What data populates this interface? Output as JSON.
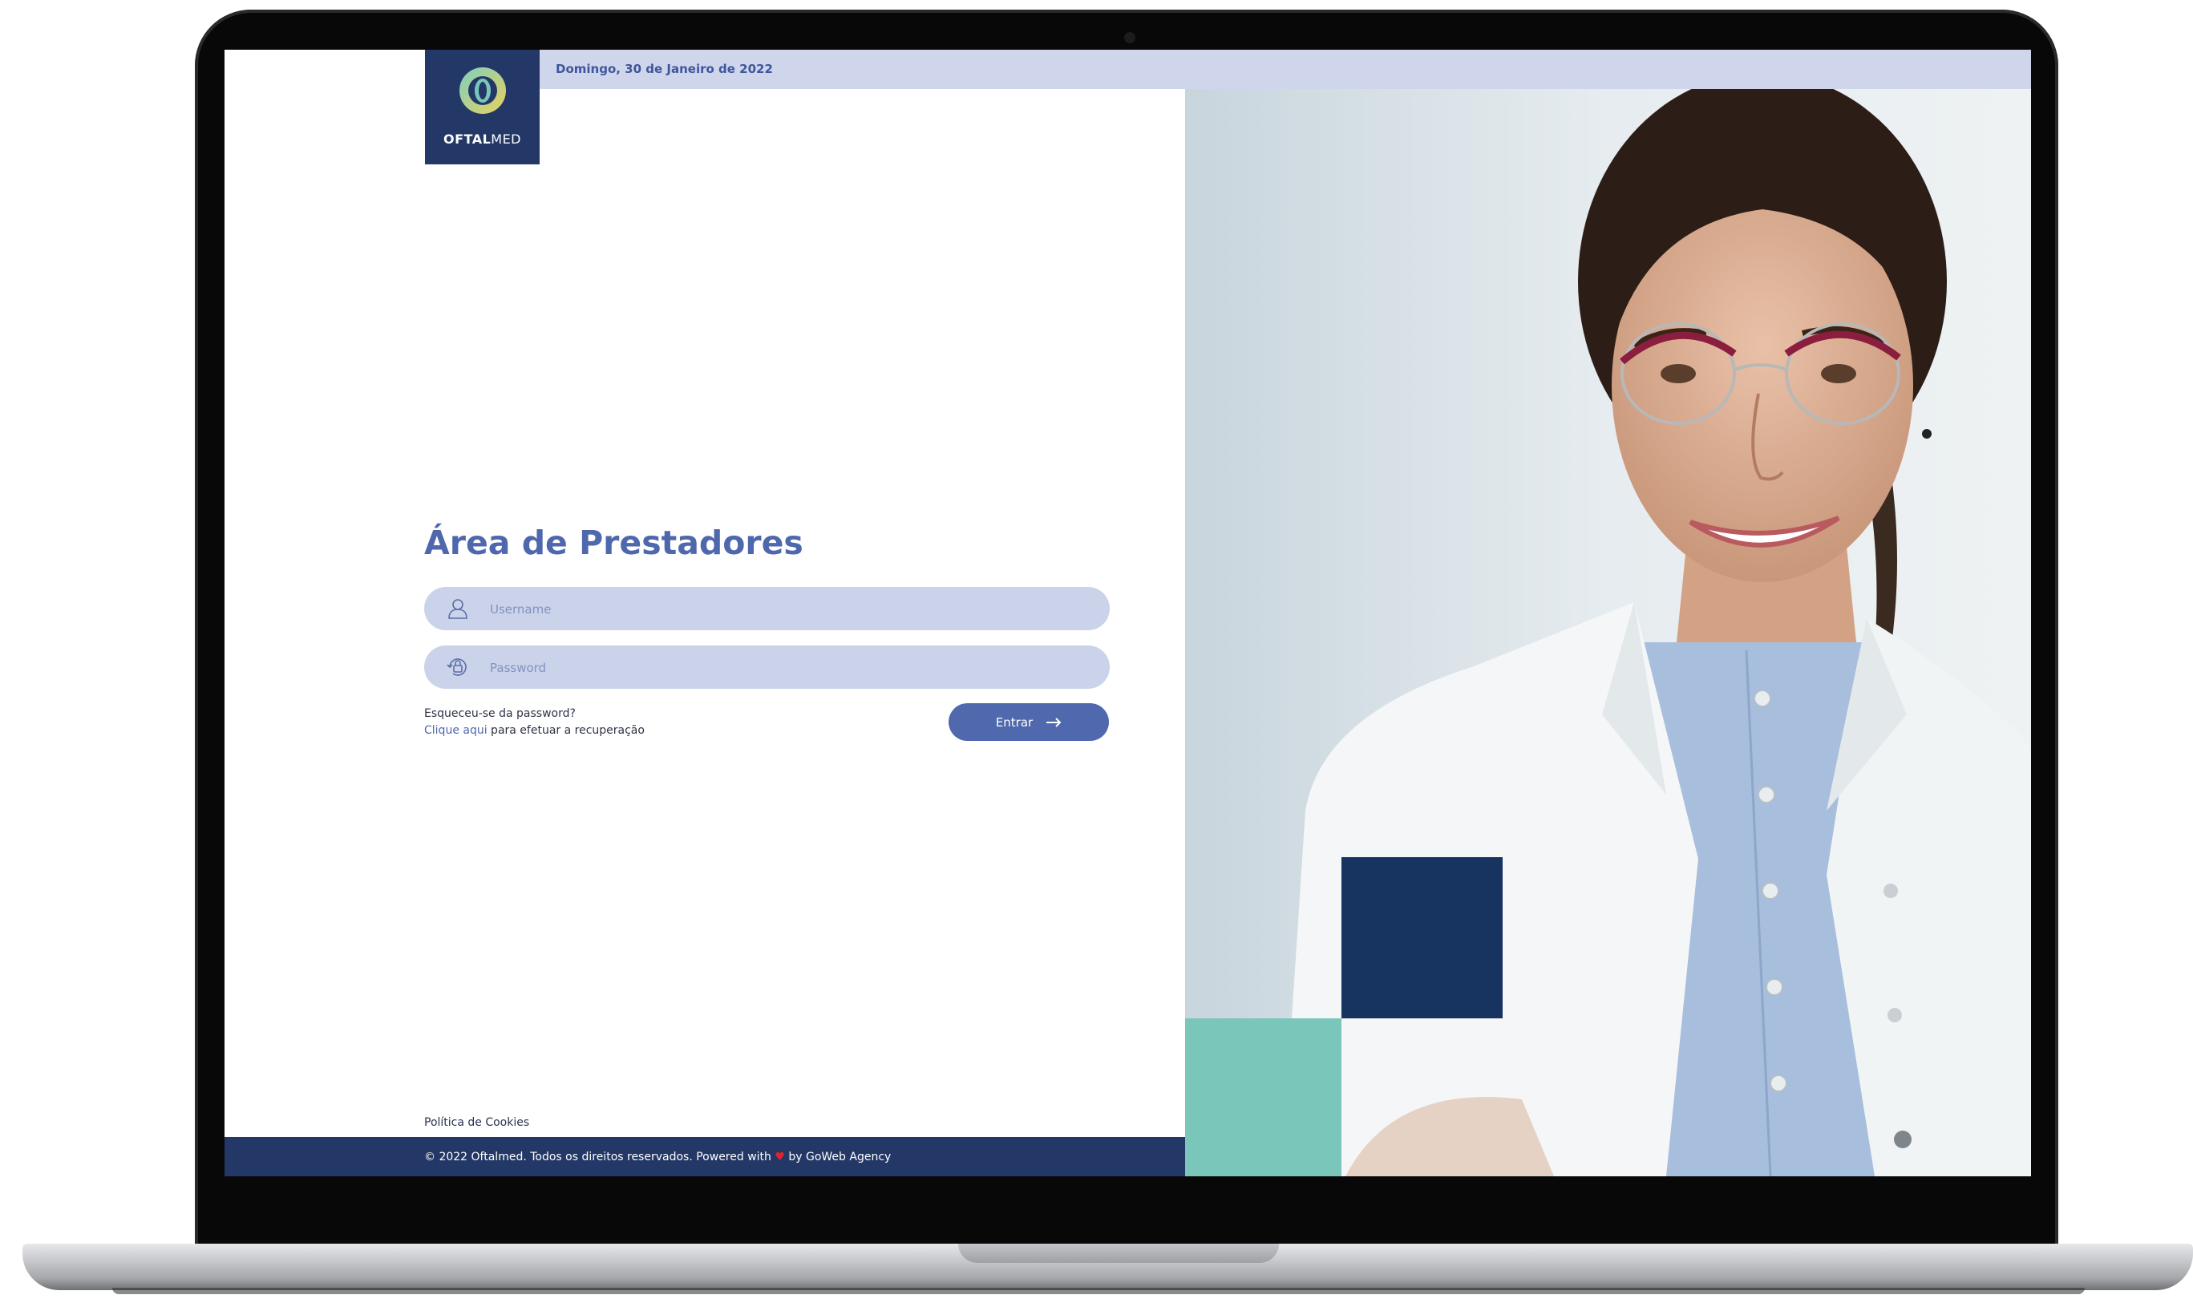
{
  "topbar": {
    "date": "Domingo, 30 de Janeiro de 2022"
  },
  "logo": {
    "brand_bold": "OFTAL",
    "brand_light": "MED"
  },
  "login": {
    "title": "Área de Prestadores",
    "username_placeholder": "Username",
    "password_placeholder": "Password",
    "forgot_question": "Esqueceu-se da password?",
    "forgot_link": "Clique aqui",
    "forgot_rest": " para efetuar a recuperação",
    "submit_label": "Entrar"
  },
  "footer": {
    "cookies_link": "Política de Cookies",
    "copyright_before": "© 2022 Oftalmed. Todos os direitos reservados. Powered with ",
    "heart": "♥",
    "copyright_after": " by GoWeb Agency"
  },
  "colors": {
    "navy": "#233867",
    "accent": "#5068ae",
    "field_bg": "#cbd3ea",
    "topbar_bg": "#cfd5ea",
    "teal": "#7bc6ba",
    "square_navy": "#17335f",
    "heart": "#e0232a"
  },
  "icons": [
    "user-icon",
    "lock-icon",
    "arrow-right-icon",
    "logo-eye-icon"
  ]
}
